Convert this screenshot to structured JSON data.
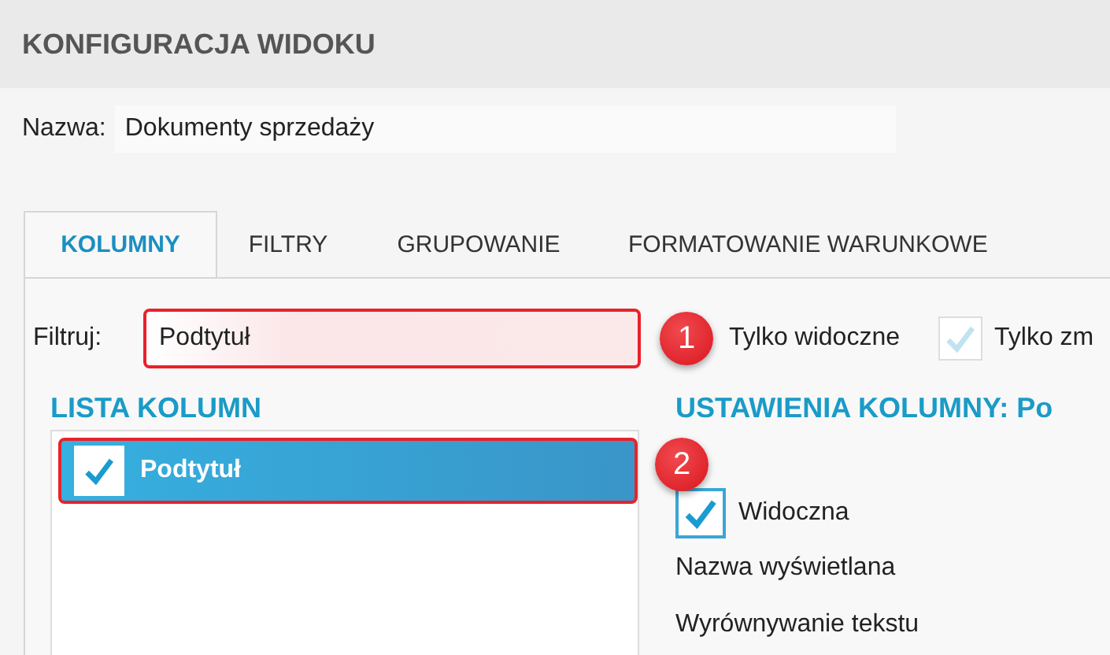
{
  "header": {
    "title": "KONFIGURACJA WIDOKU"
  },
  "name_field": {
    "label": "Nazwa:",
    "value": "Dokumenty sprzedaży"
  },
  "tabs": [
    {
      "label": "KOLUMNY",
      "selected": true
    },
    {
      "label": "FILTRY",
      "selected": false
    },
    {
      "label": "GRUPOWANIE",
      "selected": false
    },
    {
      "label": "FORMATOWANIE WARUNKOWE",
      "selected": false
    }
  ],
  "filter": {
    "label": "Filtruj:",
    "value": "Podtytuł",
    "callout": "1"
  },
  "filter_options": [
    {
      "label": "Tylko widoczne"
    },
    {
      "label": "Tylko zm",
      "checked": true,
      "disabled": true
    }
  ],
  "column_list": {
    "heading": "LISTA KOLUMN",
    "items": [
      {
        "label": "Podtytuł",
        "checked": true,
        "selected": true,
        "callout": "2"
      }
    ]
  },
  "column_settings": {
    "heading": "USTAWIENIA KOLUMNY: Po",
    "visible": {
      "label": "Widoczna",
      "checked": true
    },
    "fields": [
      "Nazwa wyświetlana",
      "Wyrównywanie tekstu"
    ]
  }
}
